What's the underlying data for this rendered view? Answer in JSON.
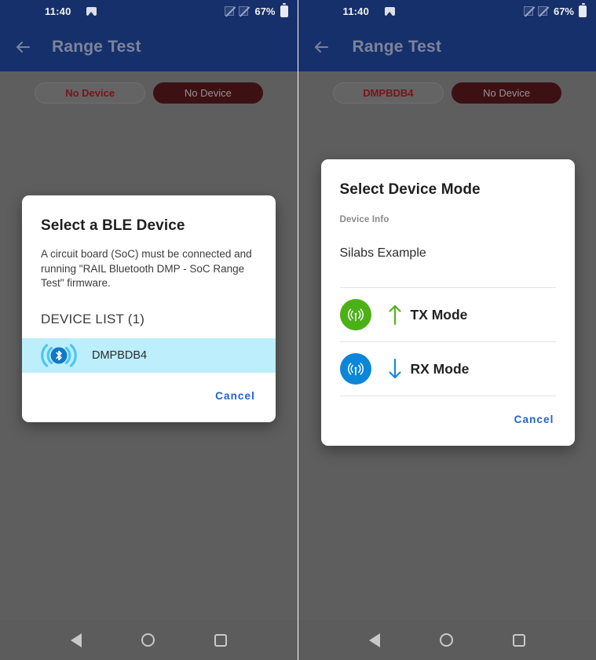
{
  "statusbar": {
    "time": "11:40",
    "battery_percent": "67%",
    "icons": [
      "photo-icon",
      "signal-off-icon",
      "signal-off-icon",
      "battery-icon"
    ]
  },
  "appbar": {
    "title": "Range Test",
    "back_icon": "back-arrow-icon"
  },
  "colors": {
    "appbar": "#16306b",
    "scrim": "#5e5e5e",
    "chip_filled": "#3d1113",
    "chip_outline_text": "#7c1317",
    "highlight_row": "#bdeefc",
    "accent_link": "#1f62d0",
    "tx_green": "#4cb017",
    "rx_blue": "#0b86d8"
  },
  "left_screen": {
    "chips": [
      {
        "label": "No Device",
        "style": "outline"
      },
      {
        "label": "No Device",
        "style": "filled"
      }
    ],
    "dialog": {
      "title": "Select a BLE Device",
      "body": "A circuit board (SoC) must be connected and running \"RAIL Bluetooth DMP - SoC Range Test\" firmware.",
      "section_label": "DEVICE LIST (1)",
      "devices": [
        {
          "name": "DMPBDB4",
          "icon": "bluetooth-icon",
          "selected": true
        }
      ],
      "cancel_label": "Cancel"
    }
  },
  "right_screen": {
    "chips": [
      {
        "label": "DMPBDB4",
        "style": "outline"
      },
      {
        "label": "No Device",
        "style": "filled"
      }
    ],
    "dialog": {
      "title": "Select Device Mode",
      "subtitle": "Device Info",
      "device_info": "Silabs Example",
      "modes": [
        {
          "label": "TX Mode",
          "icon": "antenna-icon",
          "arrow": "arrow-up-icon",
          "color": "#4cb017"
        },
        {
          "label": "RX Mode",
          "icon": "antenna-icon",
          "arrow": "arrow-down-icon",
          "color": "#0b86d8"
        }
      ],
      "cancel_label": "Cancel"
    }
  },
  "navbar": {
    "back": "nav-back-icon",
    "home": "nav-home-icon",
    "recents": "nav-recents-icon"
  }
}
